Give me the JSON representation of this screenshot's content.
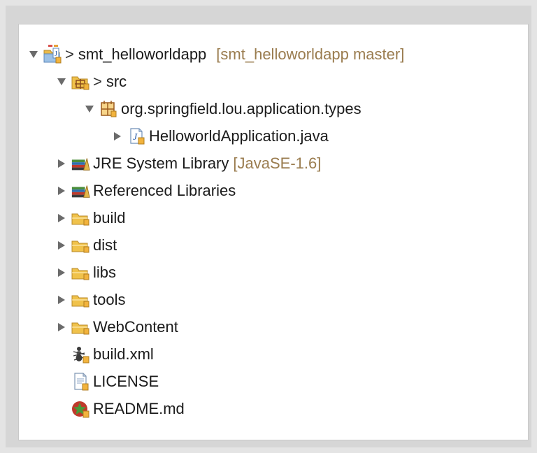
{
  "tree": {
    "project": {
      "prefix": ">",
      "label": "smt_helloworldapp",
      "decoration": "[smt_helloworldapp master]"
    },
    "src": {
      "prefix": ">",
      "label": "src"
    },
    "package": {
      "label": "org.springfield.lou.application.types"
    },
    "java_file": {
      "label": "HelloworldApplication.java"
    },
    "jre": {
      "label": "JRE System Library",
      "decoration": "[JavaSE-1.6]"
    },
    "ref_libs": {
      "label": "Referenced Libraries"
    },
    "folders": {
      "build": "build",
      "dist": "dist",
      "libs": "libs",
      "tools": "tools",
      "webcontent": "WebContent"
    },
    "files": {
      "build_xml": "build.xml",
      "license": "LICENSE",
      "readme": "README.md"
    }
  },
  "colors": {
    "decoration": "#9a7c4f",
    "folder": "#f0c24b",
    "twisty": "#6b6b6b"
  }
}
